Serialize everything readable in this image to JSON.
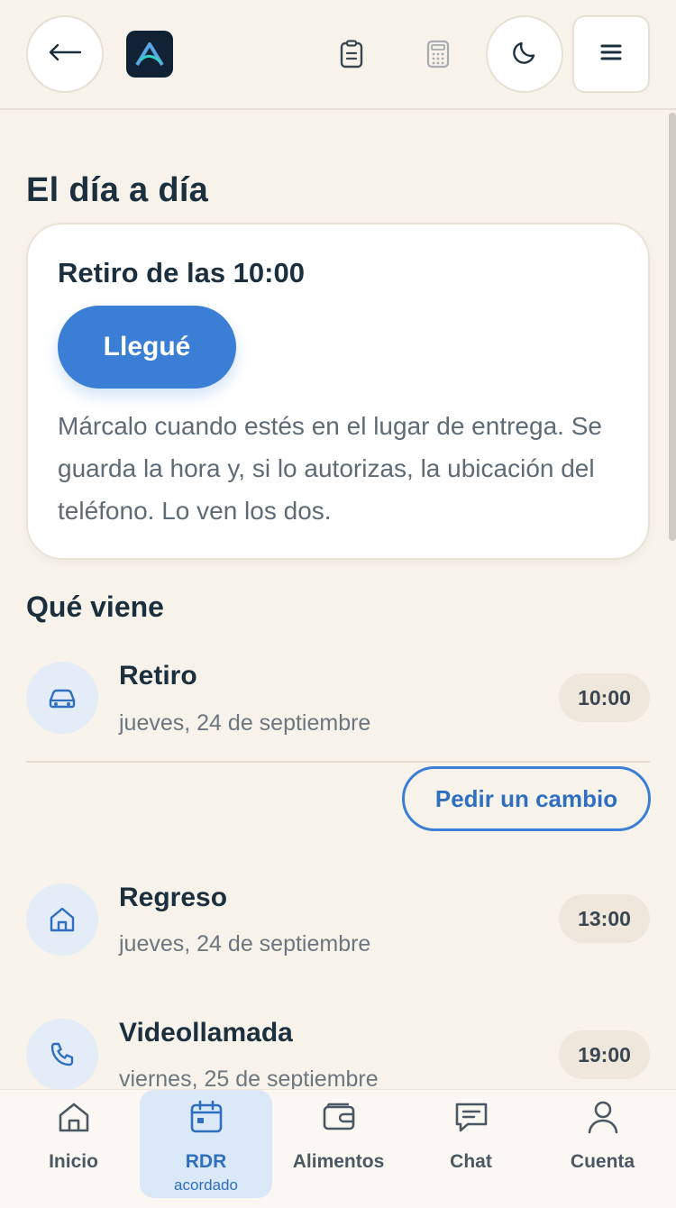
{
  "header": {
    "back_icon": "arrow-left-icon",
    "logo_icon": "app-logo",
    "clipboard_icon": "clipboard-icon",
    "calculator_icon": "calculator-icon",
    "theme_icon": "moon-icon",
    "menu_icon": "hamburger-icon"
  },
  "main": {
    "title": "El día a día",
    "card": {
      "title": "Retiro de las 10:00",
      "button_label": "Llegué",
      "description": "Márcalo cuando estés en el lugar de entrega. Se guarda la hora y, si lo autorizas, la ubicación del teléfono. Lo ven los dos."
    },
    "upcoming": {
      "title": "Qué viene",
      "change_button": "Pedir un cambio",
      "events": [
        {
          "icon": "car-icon",
          "title": "Retiro",
          "date": "jueves, 24 de septiembre",
          "time": "10:00"
        },
        {
          "icon": "home-icon",
          "title": "Regreso",
          "date": "jueves, 24 de septiembre",
          "time": "13:00"
        },
        {
          "icon": "phone-icon",
          "title": "Videollamada",
          "date": "viernes, 25 de septiembre",
          "time": "19:00"
        }
      ]
    }
  },
  "nav": {
    "items": [
      {
        "label": "Inicio",
        "icon": "home-icon"
      },
      {
        "label": "RDR",
        "sub": "acordado",
        "icon": "calendar-icon",
        "active": true
      },
      {
        "label": "Alimentos",
        "icon": "wallet-icon"
      },
      {
        "label": "Chat",
        "icon": "chat-icon"
      },
      {
        "label": "Cuenta",
        "icon": "user-icon"
      }
    ]
  },
  "colors": {
    "background": "#f8f3ea",
    "accent": "#3a7fd5",
    "text": "#1b2f3e"
  }
}
